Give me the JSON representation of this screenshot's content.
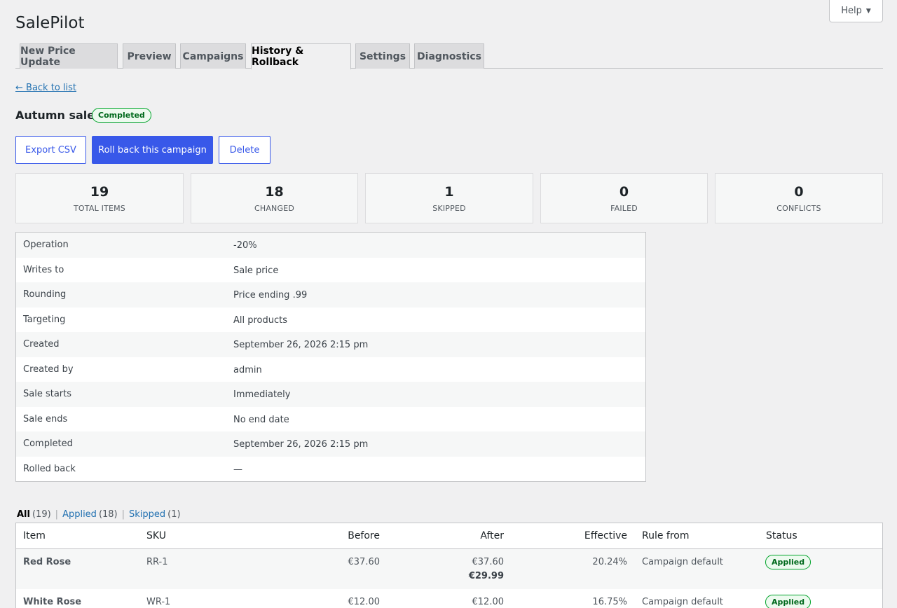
{
  "app": {
    "title": "SalePilot",
    "help_label": "Help"
  },
  "tabs": [
    {
      "label": "New Price Update"
    },
    {
      "label": "Preview"
    },
    {
      "label": "Campaigns"
    },
    {
      "label": "History & Rollback",
      "active": true
    },
    {
      "label": "Settings"
    },
    {
      "label": "Diagnostics"
    }
  ],
  "back_link": "← Back to list",
  "campaign": {
    "name": "Autumn sale",
    "status": "Completed"
  },
  "actions": {
    "export": "Export CSV",
    "rollback": "Roll back this campaign",
    "delete": "Delete"
  },
  "stats": [
    {
      "value": "19",
      "label": "TOTAL ITEMS"
    },
    {
      "value": "18",
      "label": "CHANGED"
    },
    {
      "value": "1",
      "label": "SKIPPED"
    },
    {
      "value": "0",
      "label": "FAILED"
    },
    {
      "value": "0",
      "label": "CONFLICTS"
    }
  ],
  "details": [
    {
      "key": "Operation",
      "value": "-20%"
    },
    {
      "key": "Writes to",
      "value": "Sale price"
    },
    {
      "key": "Rounding",
      "value": "Price ending .99"
    },
    {
      "key": "Targeting",
      "value": "All products"
    },
    {
      "key": "Created",
      "value": "September 26, 2026 2:15 pm"
    },
    {
      "key": "Created by",
      "value": "admin"
    },
    {
      "key": "Sale starts",
      "value": "Immediately"
    },
    {
      "key": "Sale ends",
      "value": "No end date"
    },
    {
      "key": "Completed",
      "value": "September 26, 2026 2:15 pm"
    },
    {
      "key": "Rolled back",
      "value": "—"
    }
  ],
  "filters": {
    "all_label": "All",
    "all_count": "(19)",
    "applied_label": "Applied",
    "applied_count": "(18)",
    "skipped_label": "Skipped",
    "skipped_count": "(1)"
  },
  "table": {
    "headers": {
      "item": "Item",
      "sku": "SKU",
      "before": "Before",
      "after": "After",
      "effective": "Effective",
      "rule": "Rule from",
      "status": "Status"
    },
    "rows": [
      {
        "item": "Red Rose",
        "sku": "RR-1",
        "before": "€37.60",
        "after": "€37.60",
        "after_sale": "€29.99",
        "effective": "20.24%",
        "rule": "Campaign default",
        "status": "Applied"
      },
      {
        "item": "White Rose",
        "sku": "WR-1",
        "before": "€12.00",
        "after": "€12.00",
        "after_sale": "",
        "effective": "16.75%",
        "rule": "Campaign default",
        "status": "Applied"
      }
    ]
  },
  "colors": {
    "accent": "#3858e9",
    "link": "#2271b1",
    "success": "#00a32a"
  }
}
